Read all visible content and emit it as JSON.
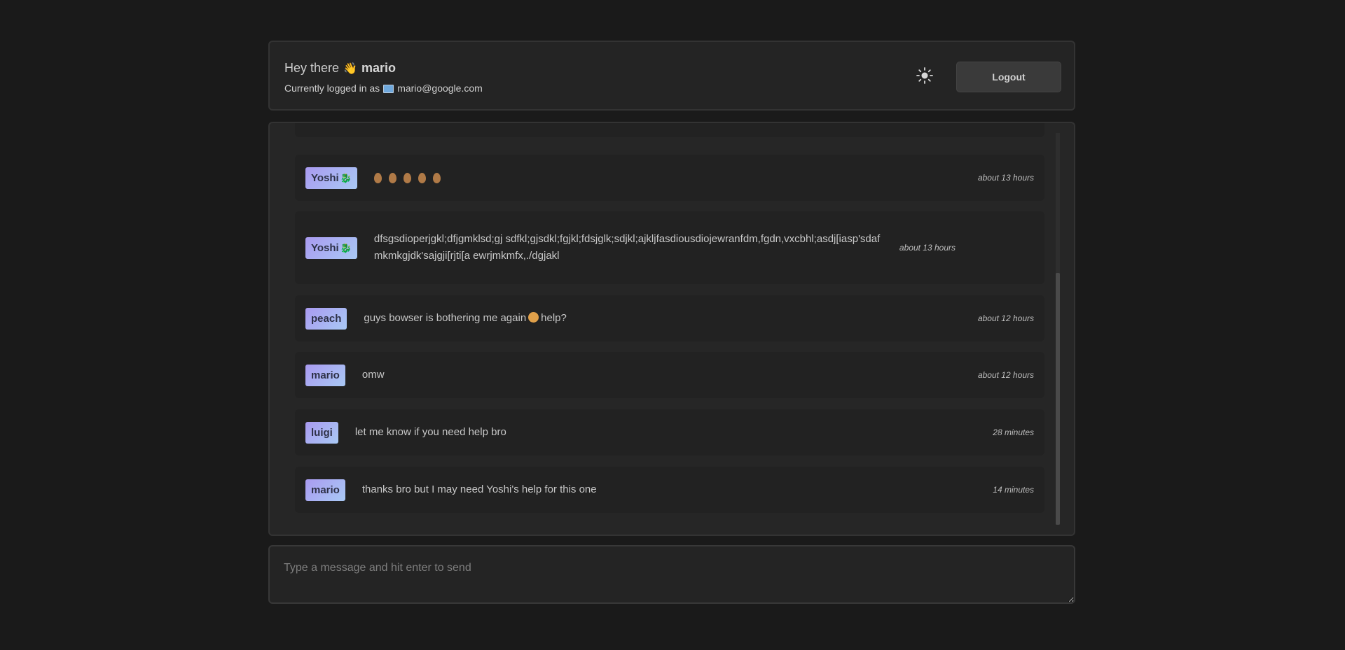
{
  "header": {
    "greeting_prefix": "Hey there",
    "wave_emoji": "👋",
    "username": "mario",
    "logged_in_prefix": "Currently logged in as",
    "email": "mario@google.com",
    "theme_icon": "sun-icon",
    "logout_label": "Logout"
  },
  "messages": [
    {
      "user": "Yoshi",
      "user_emoji": "🐉",
      "text": "",
      "eggs": 5,
      "time": "about 13 hours"
    },
    {
      "user": "Yoshi",
      "user_emoji": "🐉",
      "text": "dfsgsdioperjgkl;dfjgmklsd;gj sdfkl;gjsdkl;fgjkl;fdsjglk;sdjkl;ajkljfasdiousdiojewranfdm,fgdn,vxcbhl;asdj[iasp'sdafmkmkgjdk'sajgji[rjti[a ewrjmkmfx,./dgjakl",
      "time": "about 13 hours"
    },
    {
      "user": "peach",
      "user_emoji": "",
      "text_before": "guys bowser is bothering me again",
      "text_after": "help?",
      "time": "about 12 hours"
    },
    {
      "user": "mario",
      "user_emoji": "",
      "text": "omw",
      "time": "about 12 hours"
    },
    {
      "user": "luigi",
      "user_emoji": "",
      "text": "let me know if you need help bro",
      "time": "28 minutes"
    },
    {
      "user": "mario",
      "user_emoji": "",
      "text": "thanks bro but I may need Yoshi's help for this one",
      "time": "14 minutes"
    }
  ],
  "composer": {
    "placeholder": "Type a message and hit enter to send"
  },
  "colors": {
    "background": "#1a1a1a",
    "panel": "#242424",
    "badge_gradient_start": "#a99af0",
    "badge_gradient_end": "#a9c9f5"
  }
}
